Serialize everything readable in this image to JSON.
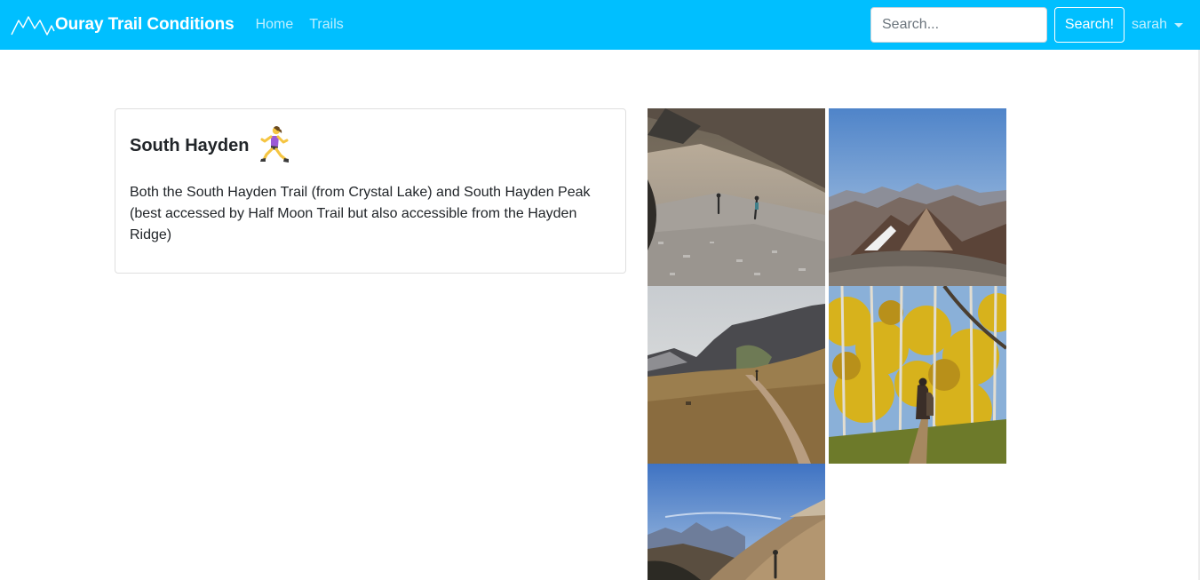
{
  "navbar": {
    "brand": "Ouray Trail Conditions",
    "links": [
      {
        "label": "Home"
      },
      {
        "label": "Trails"
      }
    ],
    "search": {
      "placeholder": "Search...",
      "value": "",
      "button_label": "Search!"
    },
    "user": {
      "name": "sarah"
    },
    "colors": {
      "background": "#00bfff",
      "text": "#ffffff"
    }
  },
  "trail": {
    "name": "South Hayden",
    "activity_icon": "woman-running-icon",
    "description": "Both the South Hayden Trail (from Crystal Lake) and South Hayden Peak (best accessed by Half Moon Trail but also accessible from the Hayden Ridge)"
  },
  "photos": [
    {
      "subject": "hikers-on-rocky-scree-slope"
    },
    {
      "subject": "mountain-ridge-panorama"
    },
    {
      "subject": "trail-through-grassy-valley"
    },
    {
      "subject": "hikers-in-aspen-forest"
    },
    {
      "subject": "hiker-on-mountain-slope"
    }
  ]
}
